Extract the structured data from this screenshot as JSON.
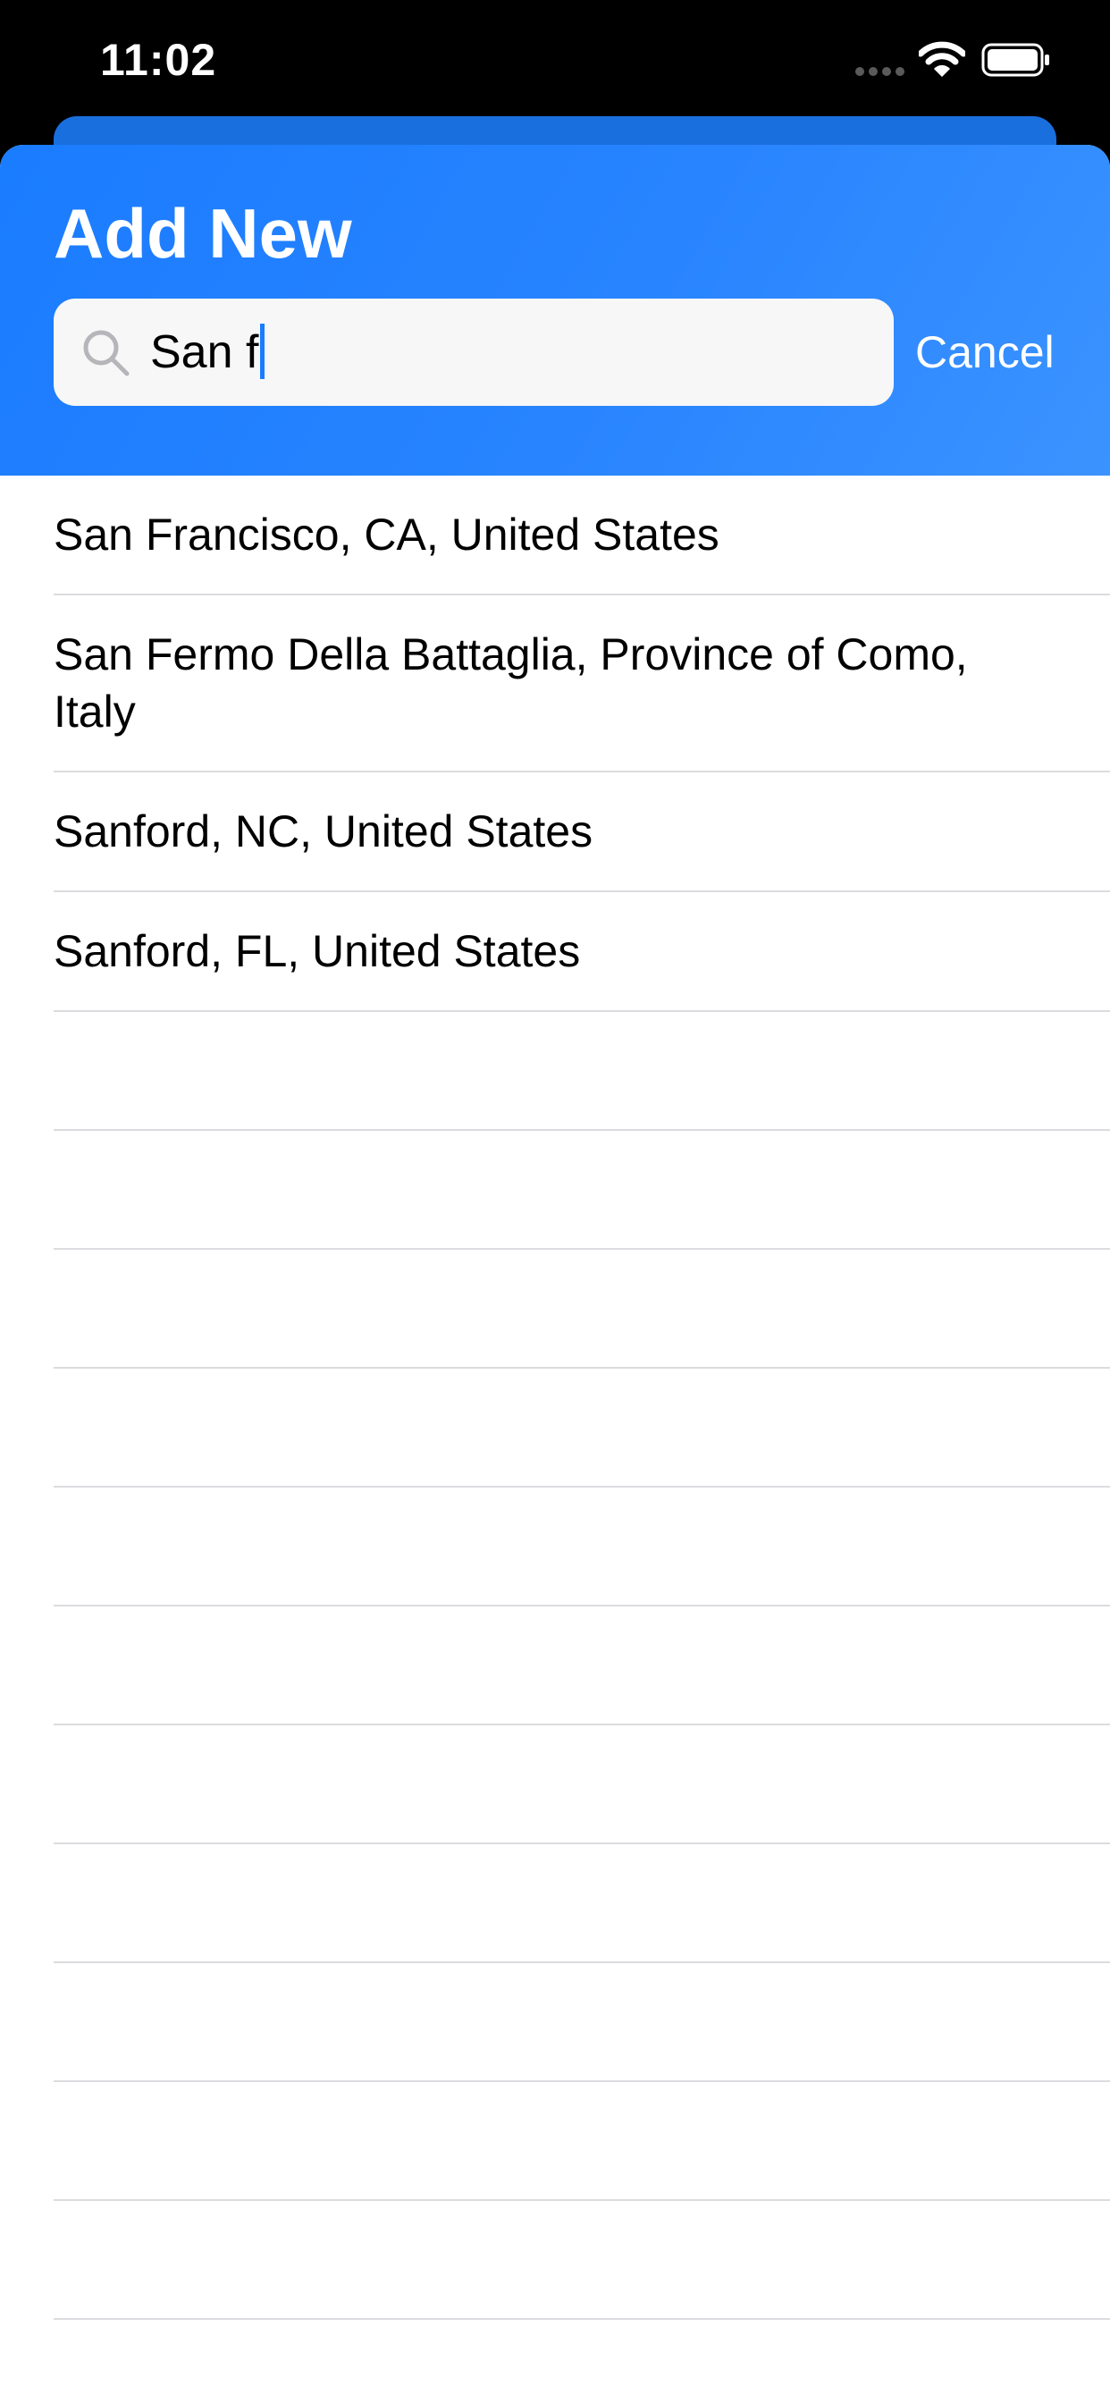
{
  "status_bar": {
    "time": "11:02",
    "icons": [
      "cellular-signal-icon",
      "wifi-icon",
      "battery-icon"
    ]
  },
  "header": {
    "title": "Add New",
    "background_color": "#1a7cff"
  },
  "search": {
    "value": "San f",
    "icon": "search-icon",
    "cursor_color": "#1a7cff"
  },
  "cancel_label": "Cancel",
  "results": [
    "San Francisco, CA, United States",
    "San Fermo Della Battaglia, Province of Como, Italy",
    "Sanford, NC, United States",
    "Sanford, FL, United States"
  ]
}
